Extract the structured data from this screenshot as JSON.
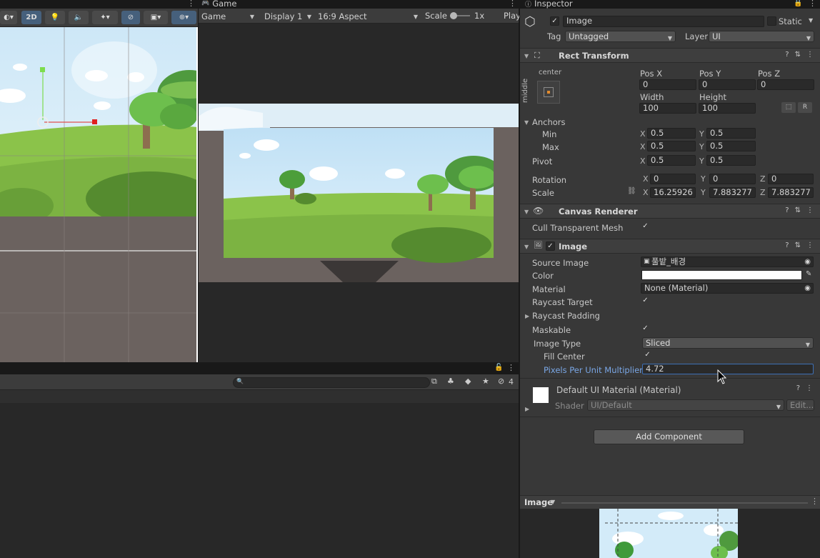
{
  "scene_toolbar": {
    "mode_2d": "2D"
  },
  "game": {
    "tab_label": "Game",
    "view_dropdown": "Game",
    "display_dropdown": "Display 1",
    "aspect_dropdown": "16:9 Aspect",
    "scale_label": "Scale",
    "scale_value": "1x",
    "play_label": "Play"
  },
  "bottom": {
    "hidden_count": "4"
  },
  "inspector": {
    "tab_label": "Inspector",
    "object_name": "Image",
    "static_label": "Static",
    "tag_label": "Tag",
    "tag_value": "Untagged",
    "layer_label": "Layer",
    "layer_value": "UI",
    "rect_transform": {
      "title": "Rect Transform",
      "anchor_h": "center",
      "anchor_v": "middle",
      "pos_x_label": "Pos X",
      "pos_y_label": "Pos Y",
      "pos_z_label": "Pos Z",
      "pos_x": "0",
      "pos_y": "0",
      "pos_z": "0",
      "width_label": "Width",
      "height_label": "Height",
      "width": "100",
      "height": "100",
      "raw_button": "R",
      "anchors_label": "Anchors",
      "min_label": "Min",
      "max_label": "Max",
      "min_x": "0.5",
      "min_y": "0.5",
      "max_x": "0.5",
      "max_y": "0.5",
      "pivot_label": "Pivot",
      "pivot_x": "0.5",
      "pivot_y": "0.5",
      "rotation_label": "Rotation",
      "rot_x": "0",
      "rot_y": "0",
      "rot_z": "0",
      "scale_label": "Scale",
      "scale_x": "16.25926",
      "scale_y": "7.883277",
      "scale_z": "7.883277",
      "x": "X",
      "y": "Y",
      "z": "Z"
    },
    "canvas_renderer": {
      "title": "Canvas Renderer",
      "cull_label": "Cull Transparent Mesh"
    },
    "image": {
      "title": "Image",
      "source_image_label": "Source Image",
      "source_image_value": "풀밭_배경",
      "color_label": "Color",
      "material_label": "Material",
      "material_value": "None (Material)",
      "raycast_target_label": "Raycast Target",
      "raycast_padding_label": "Raycast Padding",
      "maskable_label": "Maskable",
      "image_type_label": "Image Type",
      "image_type_value": "Sliced",
      "fill_center_label": "Fill Center",
      "ppu_label": "Pixels Per Unit Multiplier",
      "ppu_value": "4.72"
    },
    "material": {
      "name": "Default UI Material (Material)",
      "shader_label": "Shader",
      "shader_value": "UI/Default",
      "edit_button": "Edit..."
    },
    "add_component": "Add Component",
    "preview_label": "Image"
  }
}
